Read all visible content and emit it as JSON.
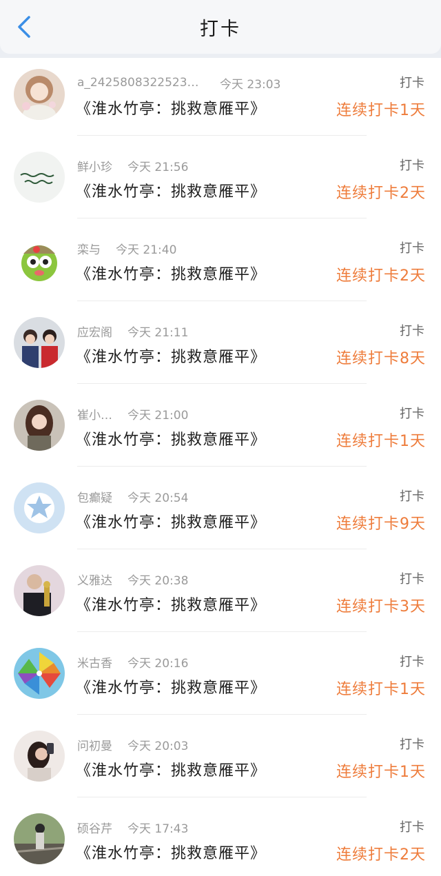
{
  "header": {
    "title": "打卡",
    "back_icon": "chevron-left-icon",
    "accent": "#3a8ee6"
  },
  "colors": {
    "streak": "#ee7c3b",
    "meta": "#9a9a9a"
  },
  "items": [
    {
      "name": "a_2425808322523O…",
      "time": "今天 23:03",
      "poem": "《淮水竹亭：挑救意雁平》",
      "tag": "打卡",
      "streak": "连续打卡1天",
      "avatar": "girl-illustration-avatar"
    },
    {
      "name": "鲜小珍",
      "time": "今天 21:56",
      "poem": "《淮水竹亭：挑救意雁平》",
      "tag": "打卡",
      "streak": "连续打卡2天",
      "avatar": "handwriting-avatar"
    },
    {
      "name": "栾与",
      "time": "今天 21:40",
      "poem": "《淮水竹亭：挑救意雁平》",
      "tag": "打卡",
      "streak": "连续打卡2天",
      "avatar": "frog-cartoon-avatar"
    },
    {
      "name": "应宏阁",
      "time": "今天 21:11",
      "poem": "《淮水竹亭：挑救意雁平》",
      "tag": "打卡",
      "streak": "连续打卡8天",
      "avatar": "two-girls-avatar"
    },
    {
      "name": "崔小…",
      "time": "今天 21:00",
      "poem": "《淮水竹亭：挑救意雁平》",
      "tag": "打卡",
      "streak": "连续打卡1天",
      "avatar": "girl-photo-avatar"
    },
    {
      "name": "包癫疑",
      "time": "今天 20:54",
      "poem": "《淮水竹亭：挑救意雁平》",
      "tag": "打卡",
      "streak": "连续打卡9天",
      "avatar": "default-star-avatar"
    },
    {
      "name": "义雅达",
      "time": "今天 20:38",
      "poem": "《淮水竹亭：挑救意雁平》",
      "tag": "打卡",
      "streak": "连续打卡3天",
      "avatar": "man-trophy-avatar"
    },
    {
      "name": "米古香",
      "time": "今天 20:16",
      "poem": "《淮水竹亭：挑救意雁平》",
      "tag": "打卡",
      "streak": "连续打卡1天",
      "avatar": "pinwheel-avatar"
    },
    {
      "name": "问初曼",
      "time": "今天 20:03",
      "poem": "《淮水竹亭：挑救意雁平》",
      "tag": "打卡",
      "streak": "连续打卡1天",
      "avatar": "girl-phone-avatar"
    },
    {
      "name": "硕谷芹",
      "time": "今天 17:43",
      "poem": "《淮水竹亭：挑救意雁平》",
      "tag": "打卡",
      "streak": "连续打卡2天",
      "avatar": "railway-girl-avatar"
    }
  ]
}
